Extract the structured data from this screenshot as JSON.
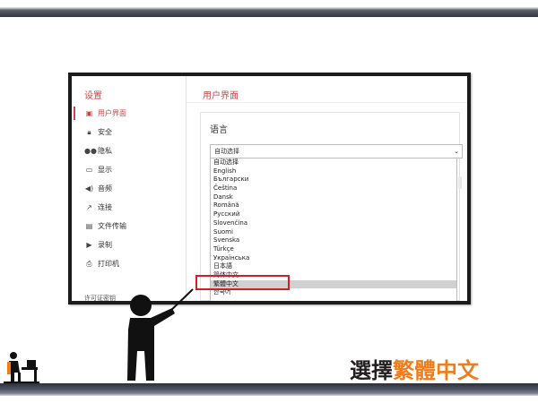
{
  "settings": {
    "sidebar_title": "设置",
    "nav": [
      {
        "icon": "monitor-icon",
        "label": "用户界面",
        "active": true
      },
      {
        "icon": "lock-icon",
        "label": "安全",
        "active": false
      },
      {
        "icon": "glasses-icon",
        "label": "隐私",
        "active": false
      },
      {
        "icon": "display-icon",
        "label": "显示",
        "active": false
      },
      {
        "icon": "speaker-icon",
        "label": "音频",
        "active": false
      },
      {
        "icon": "plug-icon",
        "label": "连接",
        "active": false
      },
      {
        "icon": "file-icon",
        "label": "文件传输",
        "active": false
      },
      {
        "icon": "record-icon",
        "label": "录制",
        "active": false
      },
      {
        "icon": "printer-icon",
        "label": "打印机",
        "active": false
      }
    ],
    "nav_footer": "许可证密钥",
    "main_title": "用户界面",
    "section_title": "语言",
    "select_value": "自动选择",
    "language_options": [
      "自动选择",
      "English",
      "Български",
      "Čeština",
      "Dansk",
      "Română",
      "Русский",
      "Slovenčina",
      "Suomi",
      "Svenska",
      "Türkçe",
      "Українська",
      "日本語",
      "简体中文",
      "繁體中文",
      "한국어"
    ],
    "selected_option": "繁體中文"
  },
  "caption": {
    "prefix": "選擇",
    "highlight": "繁體中文"
  },
  "colors": {
    "accent_red": "#c3484a",
    "highlight_box": "#d11f27",
    "caption_orange": "#f07d1a",
    "caption_dark": "#231f20"
  }
}
